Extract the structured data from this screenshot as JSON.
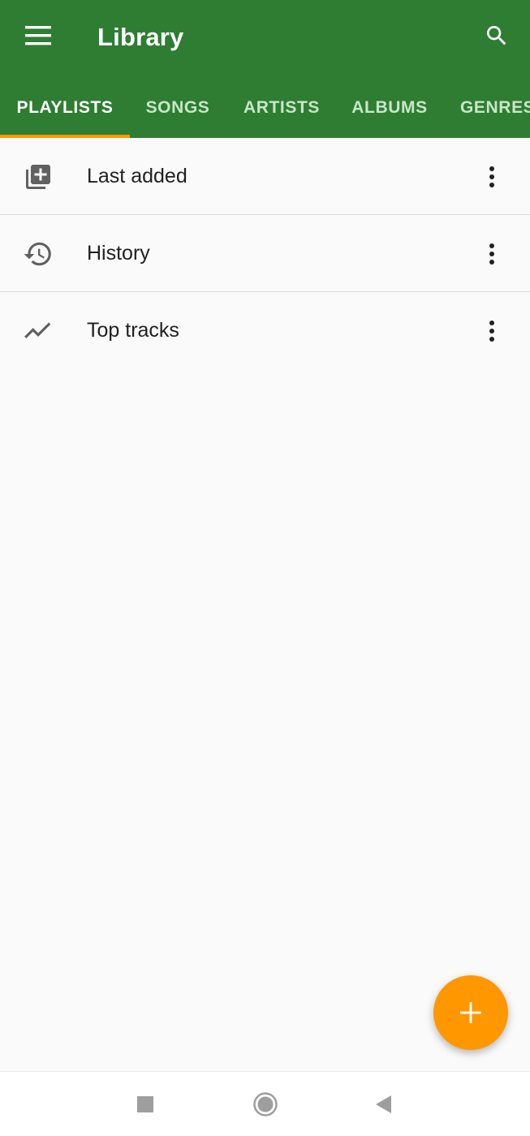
{
  "appbar": {
    "title": "Library",
    "menu_icon": "hamburger-menu-icon",
    "search_icon": "search-icon",
    "background": "#2e7d32"
  },
  "tabs": [
    {
      "label": "PLAYLISTS",
      "active": true
    },
    {
      "label": "SONGS",
      "active": false
    },
    {
      "label": "ARTISTS",
      "active": false
    },
    {
      "label": "ALBUMS",
      "active": false
    },
    {
      "label": "GENRES",
      "active": false
    }
  ],
  "accent": "#ff9800",
  "playlists": [
    {
      "label": "Last added",
      "icon": "library-add-icon"
    },
    {
      "label": "History",
      "icon": "history-icon"
    },
    {
      "label": "Top tracks",
      "icon": "trending-up-icon"
    }
  ],
  "fab": {
    "icon": "plus-icon"
  },
  "system_nav": [
    "recents-square-icon",
    "home-circle-icon",
    "back-triangle-icon"
  ]
}
